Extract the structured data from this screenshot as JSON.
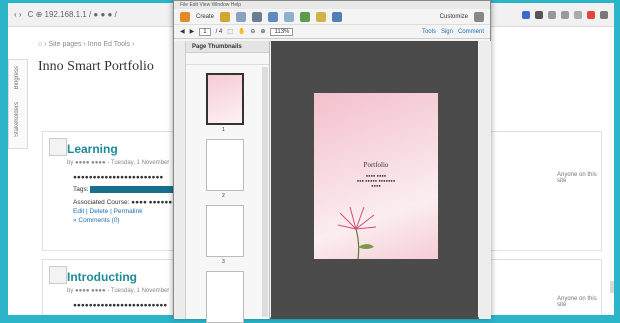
{
  "browser": {
    "url": "C  ⊕ 192.168.1.1 / ● ● ● /"
  },
  "site": {
    "breadcrumb": "⌂  ›  Site pages  ›  Inno Ed Tools  ›",
    "side_tabs": [
      "Bingress",
      "Stakeholders"
    ],
    "title": "Inno Smart Portfolio",
    "posts": [
      {
        "title": "Learning",
        "meta": "by ●●●● ●●●● - Tuesday, 1 November",
        "body": "●●●●●●●●●●●●●●●●●●●●●●●",
        "tags_label": "Tags:",
        "assoc": "Associated Course: ●●●● ●●●●●●●",
        "links": "Edit | Delete | Permalink",
        "comments": "» Comments (0)",
        "visibility": "Anyone on this site"
      },
      {
        "title": "Introducting",
        "meta": "by ●●●● ●●●● - Tuesday, 1 November",
        "body": "●●●●●●●●●●●●●●●●●●●●●●●●",
        "visibility": "Anyone on this site"
      }
    ]
  },
  "pdf": {
    "menu": "File  Edit  View  Window  Help",
    "create": "Create",
    "customize": "Customize",
    "page_current": "1",
    "page_total": "/ 4",
    "zoom": "113%",
    "tools": "Tools",
    "sign": "Sign",
    "comment": "Comment",
    "panel_title": "Page Thumbnails",
    "page_nums": [
      "1",
      "2",
      "3"
    ],
    "doc_title": "Portfolio",
    "doc_author": "●●●● ●●●●",
    "doc_sub1": "●●● ●●●●● ●●●●●●●",
    "doc_sub2": "●●●●"
  },
  "colors": {
    "accent": "#2cb4c9",
    "link": "#1e8b97",
    "tag": "#1a6e8e"
  }
}
